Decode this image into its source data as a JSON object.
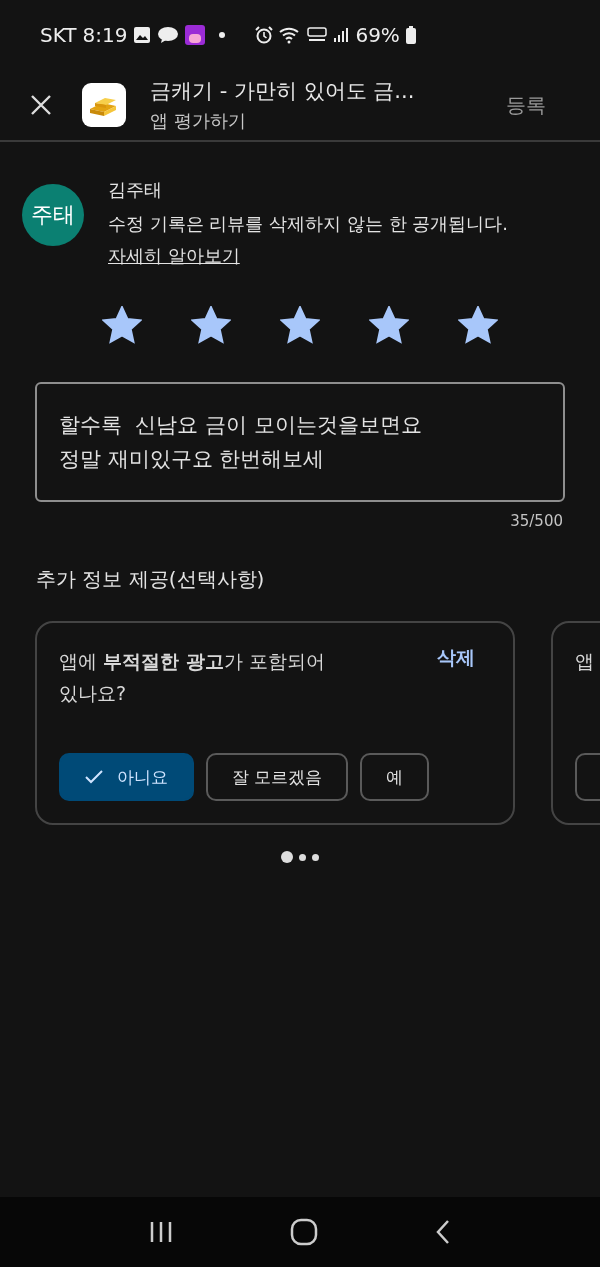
{
  "status_bar": {
    "carrier": "SKT",
    "time": "8:19",
    "battery": "69%"
  },
  "header": {
    "title": "금캐기 - 가만히 있어도 금...",
    "subtitle": "앱 평가하기",
    "submit": "등록",
    "submit_disabled": true
  },
  "reviewer": {
    "initials": "주태",
    "name": "김주태",
    "notice": "수정 기록은 리뷰를 삭제하지 않는 한 공개됩니다.",
    "link": "자세히 알아보기"
  },
  "rating": {
    "stars": 5
  },
  "review": {
    "value": "할수록  신남요 금이 모이는것을보면요\n정말 재미있구요 한번해보세",
    "counter": "35/500"
  },
  "extra_heading": "추가 정보 제공(선택사항)",
  "questions": [
    {
      "text": "앱에 **부적절한 광고**가 포함되어 있나요?",
      "clear": "삭제",
      "options": [
        {
          "label": "아니요",
          "selected": true
        },
        {
          "label": "잘 모르겠음",
          "selected": false
        },
        {
          "label": "예",
          "selected": false
        }
      ]
    },
    {
      "text": "앱",
      "options": [
        {
          "selected": false
        }
      ]
    }
  ],
  "pager": [
    {
      "selected": true
    },
    {
      "selected": false
    },
    {
      "selected": false
    }
  ]
}
